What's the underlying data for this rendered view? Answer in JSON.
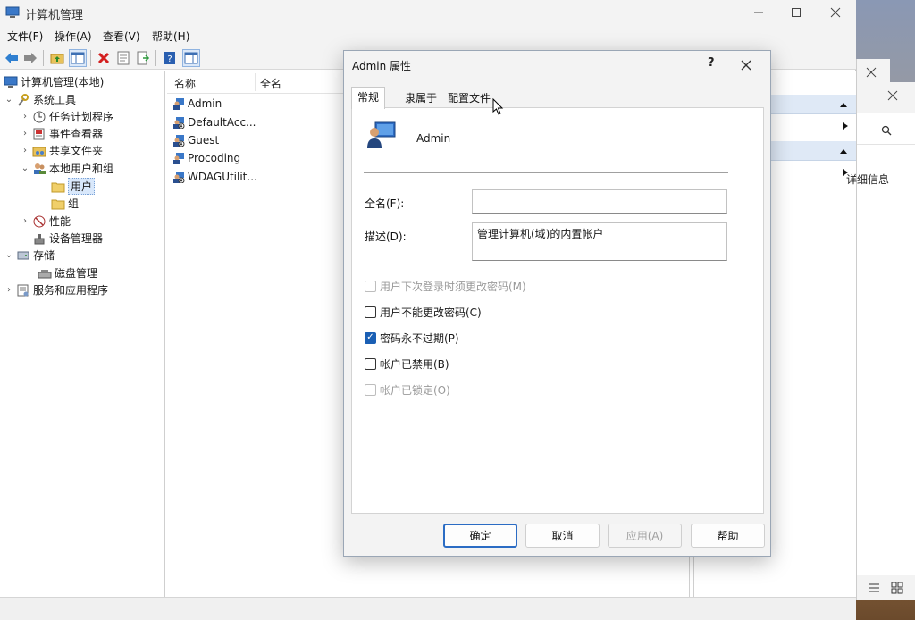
{
  "app": {
    "title": "计算机管理"
  },
  "menu": [
    "文件(F)",
    "操作(A)",
    "查看(V)",
    "帮助(H)"
  ],
  "tree": {
    "root": "计算机管理(本地)",
    "items": [
      {
        "label": "系统工具"
      },
      {
        "label": "任务计划程序"
      },
      {
        "label": "事件查看器"
      },
      {
        "label": "共享文件夹"
      },
      {
        "label": "本地用户和组"
      },
      {
        "label": "用户"
      },
      {
        "label": "组"
      },
      {
        "label": "性能"
      },
      {
        "label": "设备管理器"
      },
      {
        "label": "存储"
      },
      {
        "label": "磁盘管理"
      },
      {
        "label": "服务和应用程序"
      }
    ]
  },
  "list": {
    "columns": [
      "名称",
      "全名"
    ],
    "rows": [
      "Admin",
      "DefaultAcc...",
      "Guest",
      "Procoding",
      "WDAGUtilit..."
    ]
  },
  "background_window": {
    "detail": "详细信息"
  },
  "dialog": {
    "title": "Admin 属性",
    "help": "?",
    "tabs": [
      "常规",
      "隶属于",
      "配置文件"
    ],
    "active_tab": "常规",
    "user_name": "Admin",
    "fullname_label": "全名(F):",
    "fullname_value": "",
    "description_label": "描述(D):",
    "description_value": "管理计算机(域)的内置帐户",
    "checkboxes": [
      {
        "label": "用户下次登录时须更改密码(M)",
        "checked": false,
        "disabled": true
      },
      {
        "label": "用户不能更改密码(C)",
        "checked": false,
        "disabled": false
      },
      {
        "label": "密码永不过期(P)",
        "checked": true,
        "disabled": false
      },
      {
        "label": "帐户已禁用(B)",
        "checked": false,
        "disabled": false
      },
      {
        "label": "帐户已锁定(O)",
        "checked": false,
        "disabled": true
      }
    ],
    "buttons": {
      "ok": "确定",
      "cancel": "取消",
      "apply": "应用(A)",
      "help": "帮助"
    }
  },
  "colors": {
    "accent": "#1a5fb4",
    "selection": "#d9e8fb",
    "action_header": "#dfe9f6"
  }
}
